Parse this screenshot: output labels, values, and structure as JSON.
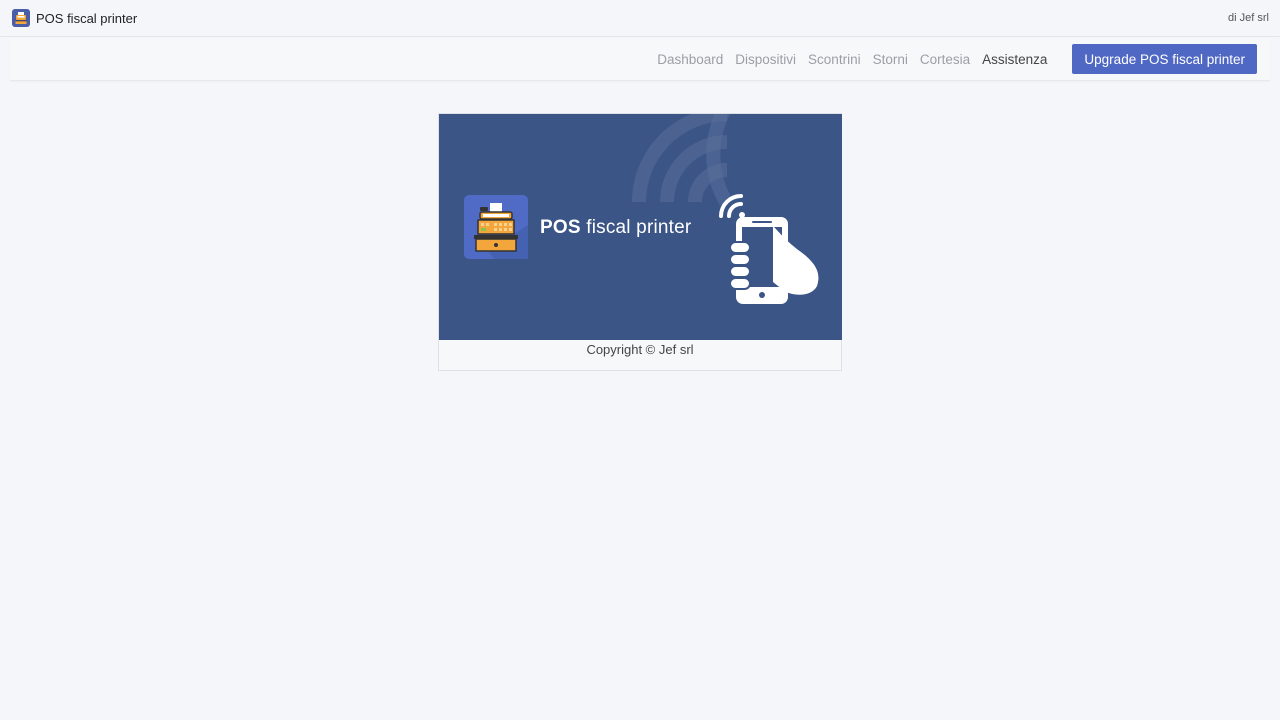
{
  "app": {
    "title": "POS fiscal printer",
    "vendor": "di Jef srl",
    "icon": "cash-register-icon"
  },
  "nav": {
    "items": [
      {
        "label": "Dashboard",
        "active": false
      },
      {
        "label": "Dispositivi",
        "active": false
      },
      {
        "label": "Scontrini",
        "active": false
      },
      {
        "label": "Storni",
        "active": false
      },
      {
        "label": "Cortesia",
        "active": false
      },
      {
        "label": "Assistenza",
        "active": true
      }
    ],
    "upgrade_label": "Upgrade POS fiscal printer"
  },
  "banner": {
    "brand_bold": "POS",
    "brand_rest": "fiscal printer",
    "icons": [
      "cash-register-icon",
      "wifi-signal-icon",
      "hand-phone-icon"
    ]
  },
  "footer": {
    "copyright": "Copyright © Jef srl"
  },
  "colors": {
    "background": "#f4f6fa",
    "accent": "#4f68c4",
    "banner": "#3b5587"
  }
}
